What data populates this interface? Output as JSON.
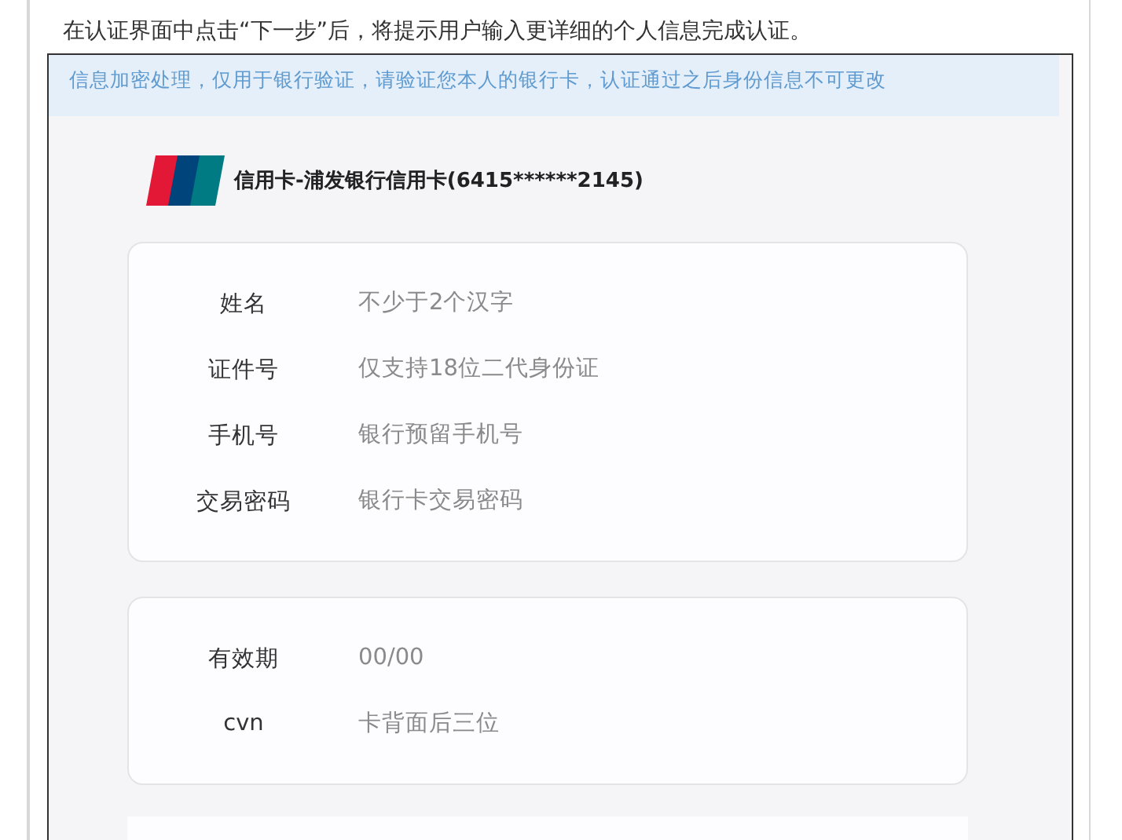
{
  "intro": "在认证界面中点击“下一步”后，将提示用户输入更详细的个人信息完成认证。",
  "notice": "信息加密处理，仅用于银行验证，请验证您本人的银行卡，认证通过之后身份信息不可更改",
  "card": {
    "title": "信用卡-浦发银行信用卡(6415******2145)"
  },
  "groups": [
    {
      "fields": [
        {
          "label": "姓名",
          "placeholder": "不少于2个汉字"
        },
        {
          "label": "证件号",
          "placeholder": "仅支持18位二代身份证"
        },
        {
          "label": "手机号",
          "placeholder": "银行预留手机号"
        },
        {
          "label": "交易密码",
          "placeholder": "银行卡交易密码"
        }
      ]
    },
    {
      "fields": [
        {
          "label": "有效期",
          "placeholder": "00/00"
        },
        {
          "label": "cvn",
          "placeholder": "卡背面后三位"
        }
      ]
    }
  ]
}
